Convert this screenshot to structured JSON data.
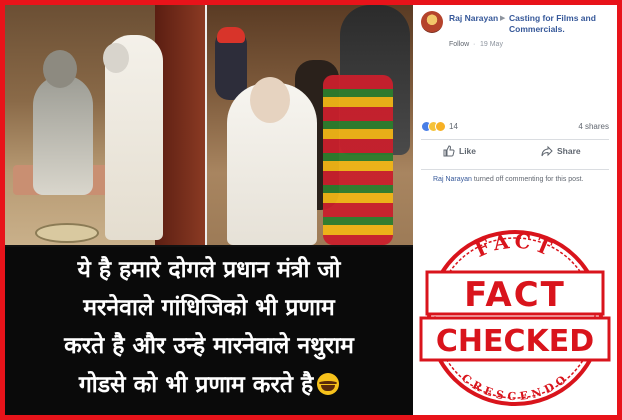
{
  "caption": {
    "line1": "ये है हमारे दोगले प्रधान मंत्री जो",
    "line2": "मरनेवाले गांधिजिको भी प्रणाम",
    "line3": "करते है और उन्हे मारनेवाले नथुराम",
    "line4": "गोडसे को भी प्रणाम करते है"
  },
  "post": {
    "author": "Raj Narayan",
    "group": "Casting for Films and Commercials.",
    "follow_label": "Follow",
    "dot": "·",
    "date": "19 May",
    "reaction_count": "14",
    "share_count": "4 shares",
    "like_label": "Like",
    "share_label": "Share",
    "notice_name": "Raj Narayan",
    "notice_text": " turned off commenting for this post."
  },
  "stamp": {
    "top_text": "FACT",
    "main_line1": "FACT",
    "main_line2": "CHECKED",
    "bottom_text": "CRESCENDO",
    "color": "#d9141c"
  },
  "colors": {
    "frame": "#e8131a",
    "link": "#365899",
    "muted": "#616770"
  }
}
